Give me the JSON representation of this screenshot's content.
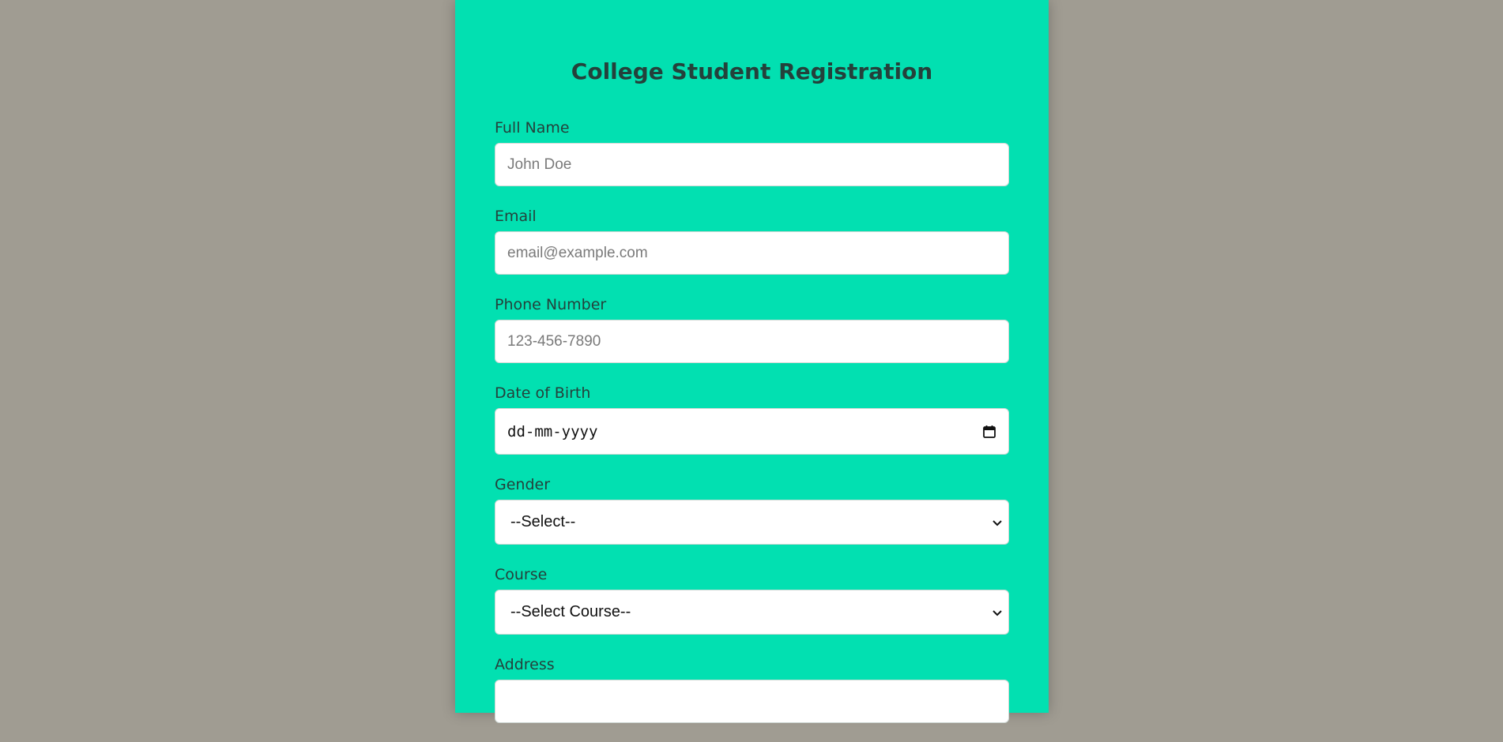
{
  "form": {
    "title": "College Student Registration",
    "fields": [
      {
        "label": "Full Name",
        "placeholder": "John Doe"
      },
      {
        "label": "Email",
        "placeholder": "email@example.com"
      },
      {
        "label": "Phone Number",
        "placeholder": "123-456-7890"
      },
      {
        "label": "Date of Birth",
        "placeholder": "dd-mm-yyyy"
      },
      {
        "label": "Gender",
        "selected": "--Select--"
      },
      {
        "label": "Course",
        "selected": "--Select Course--"
      },
      {
        "label": "Address",
        "placeholder": ""
      }
    ]
  },
  "icons": {
    "date": "calendar-icon",
    "select": "chevron-down-icon"
  },
  "colors": {
    "background": "#a09c92",
    "card": "#02e0b1",
    "text": "#24413b"
  }
}
